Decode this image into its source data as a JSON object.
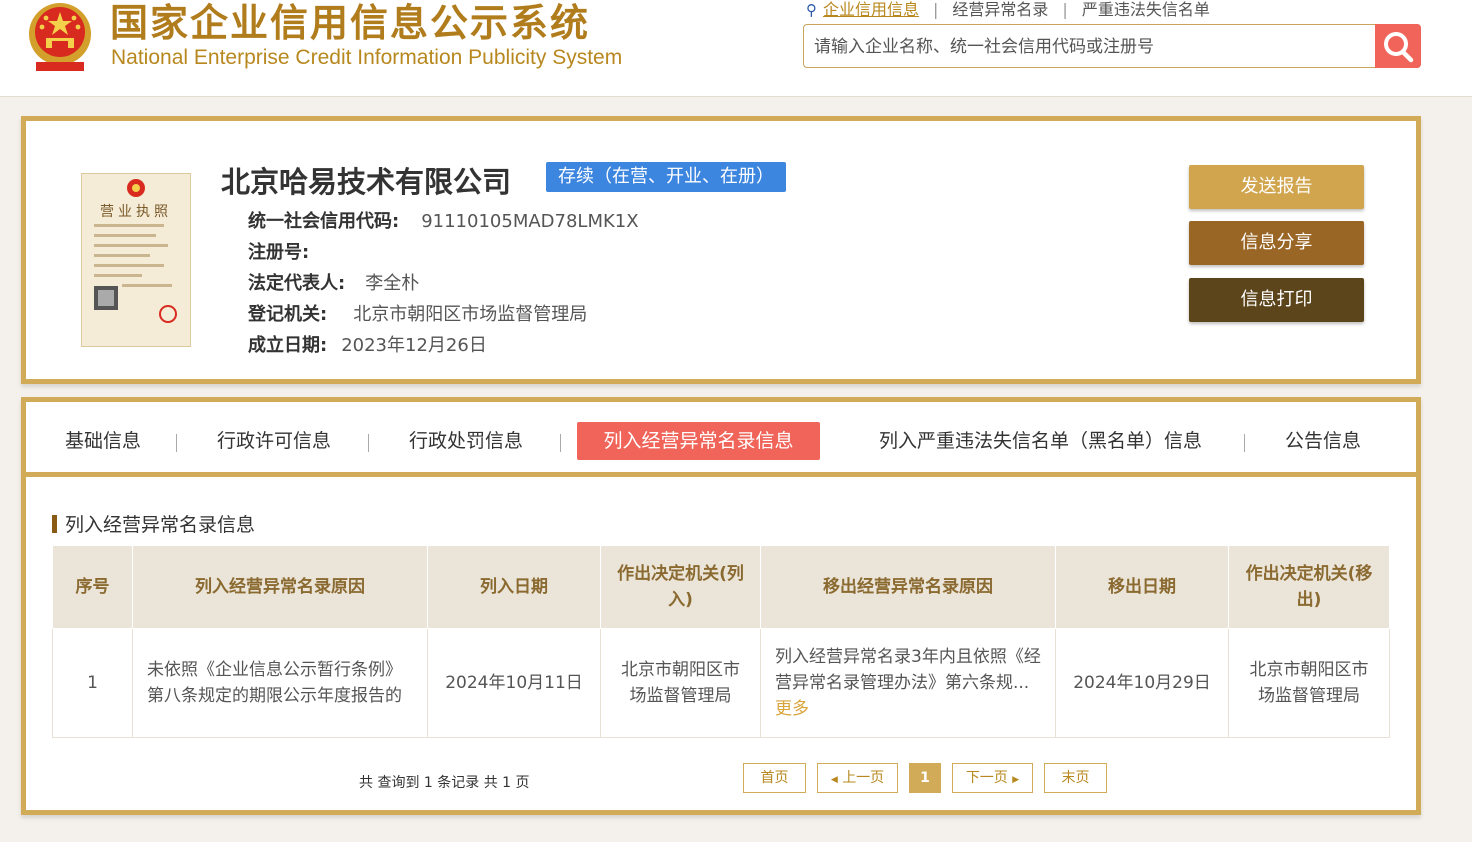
{
  "header": {
    "title_cn": "国家企业信用信息公示系统",
    "title_en": "National Enterprise Credit Information Publicity System",
    "top_links": [
      "企业信用信息",
      "经营异常名录",
      "严重违法失信名单"
    ],
    "search_placeholder": "请输入企业名称、统一社会信用代码或注册号"
  },
  "company": {
    "license_label": "营业执照",
    "name": "北京哈易技术有限公司",
    "status": "存续（在营、开业、在册）",
    "fields": [
      {
        "label": "统一社会信用代码:",
        "value": "91110105MAD78LMK1X"
      },
      {
        "label": "注册号:",
        "value": ""
      },
      {
        "label": "法定代表人:",
        "value": "李全朴"
      },
      {
        "label": "登记机关:",
        "value": "北京市朝阳区市场监督管理局"
      },
      {
        "label": "成立日期:",
        "value": "2023年12月26日"
      }
    ]
  },
  "actions": {
    "send_report": "发送报告",
    "share": "信息分享",
    "print": "信息打印"
  },
  "tabs": [
    "基础信息",
    "行政许可信息",
    "行政处罚信息",
    "列入经营异常名录信息",
    "列入严重违法失信名单（黑名单）信息",
    "公告信息"
  ],
  "section": {
    "title": "列入经营异常名录信息",
    "columns": [
      "序号",
      "列入经营异常名录原因",
      "列入日期",
      "作出决定机关(列入)",
      "移出经营异常名录原因",
      "移出日期",
      "作出决定机关(移出)"
    ],
    "rows": [
      {
        "index": "1",
        "reason_in": "未依照《企业信息公示暂行条例》第八条规定的期限公示年度报告的",
        "date_in": "2024年10月11日",
        "authority_in": "北京市朝阳区市场监督管理局",
        "reason_out": "列入经营异常名录3年内且依照《经营异常名录管理办法》第六条规...",
        "more": "更多",
        "date_out": "2024年10月29日",
        "authority_out": "北京市朝阳区市场监督管理局"
      }
    ]
  },
  "pagination": {
    "summary": "共 查询到 1 条记录 共 1 页",
    "first": "首页",
    "prev": "上一页",
    "current": "1",
    "next": "下一页",
    "last": "末页"
  },
  "colors": {
    "gold": "#d2ab58",
    "active_tab": "#f0645a",
    "badge": "#3d86e0",
    "btn_send": "#d0a54e",
    "btn_share": "#9a6625",
    "btn_print": "#5c441b"
  }
}
